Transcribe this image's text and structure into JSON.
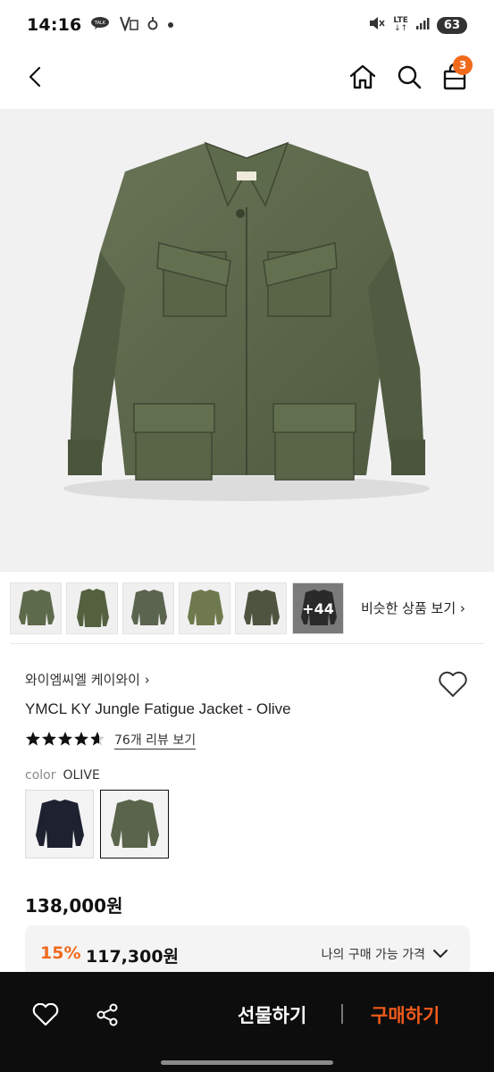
{
  "status_bar": {
    "time": "14:16",
    "battery": "63",
    "network": "LTE",
    "icons": [
      "talk-icon",
      "notification-icon",
      "alarm-icon",
      "dot-icon",
      "mute-icon",
      "wifi-icon",
      "signal-icon",
      "battery-icon"
    ]
  },
  "header": {
    "cart_count": "3",
    "icons": [
      "back-icon",
      "home-icon",
      "search-icon",
      "cart-icon"
    ]
  },
  "thumbnails": {
    "more_label": "+44",
    "similar_label": "비슷한 상품 보기 ›"
  },
  "product": {
    "brand": "와이엠씨엘 케이와이 ›",
    "name": "YMCL KY Jungle Fatigue Jacket - Olive",
    "rating": 4.5,
    "stars": "★★★★★",
    "review_link": "76개 리뷰 보기",
    "color_key": "color",
    "color_value": "OLIVE",
    "price": "138,000원",
    "discount_rate": "15%",
    "discount_price": "117,300원",
    "my_price_label": "나의 구매 가능 가격"
  },
  "bottom_bar": {
    "gift_label": "선물하기",
    "buy_label": "구매하기",
    "icons": [
      "heart-icon",
      "share-icon"
    ]
  },
  "colors": {
    "accent": "#f06a1b",
    "buy": "#f05a1b",
    "bottom_bar_bg": "#0d0d0d",
    "olive": "#59644a",
    "navy": "#1e2230"
  }
}
